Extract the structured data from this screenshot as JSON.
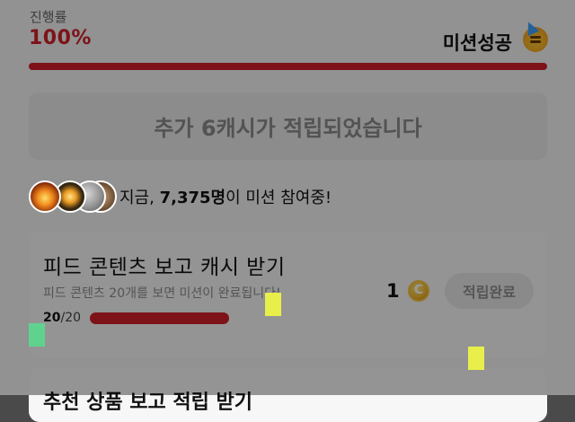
{
  "progress": {
    "label": "진행률",
    "value": "100%",
    "percent": 100,
    "status": "미션성공"
  },
  "banner": {
    "text": "추가 6캐시가 적립되었습니다"
  },
  "participants": {
    "prefix": "지금, ",
    "count": "7,375명",
    "suffix": "이 미션 참여중!"
  },
  "missions": [
    {
      "title": "피드 콘텐츠 보고 캐시 받기",
      "description": "피드 콘텐츠 20개를 보면 미션이 완료됩니다!",
      "done": "20",
      "total": "/20",
      "percent": 100,
      "reward": "1",
      "button_label": "적립완료"
    },
    {
      "title": "추천 상품 보고 적립 받기"
    }
  ],
  "colors": {
    "accent": "#d0202a",
    "coin": "#f3b52b"
  },
  "icons": [
    "party-face-icon",
    "coin-icon"
  ]
}
